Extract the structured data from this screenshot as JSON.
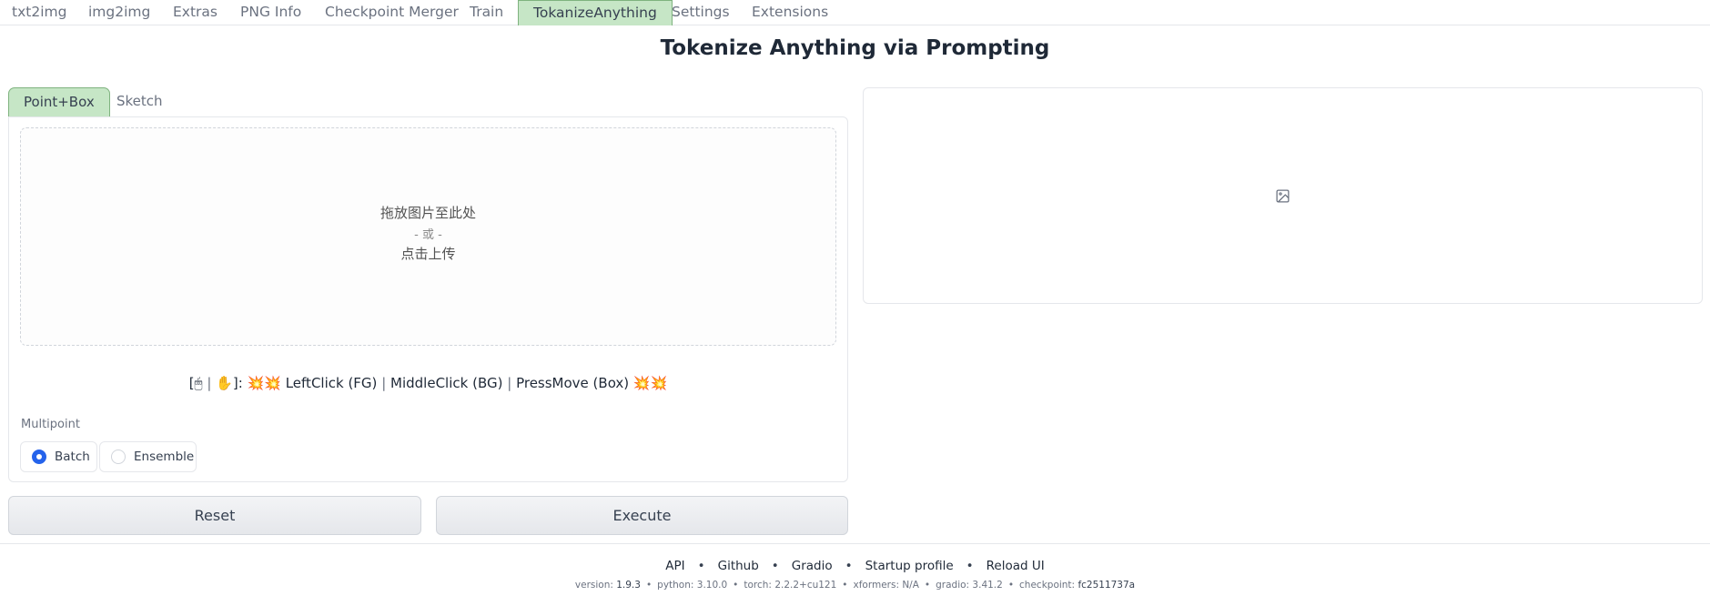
{
  "top_tabs": [
    {
      "label": "txt2img"
    },
    {
      "label": "img2img"
    },
    {
      "label": "Extras"
    },
    {
      "label": "PNG Info"
    },
    {
      "label": "Checkpoint Merger"
    },
    {
      "label": "Train"
    },
    {
      "label": "TokanizeAnything",
      "active": true
    },
    {
      "label": "Settings"
    },
    {
      "label": "Extensions"
    }
  ],
  "page_title": "Tokenize Anything via Prompting",
  "sub_tabs": [
    {
      "label": "Point+Box",
      "active": true
    },
    {
      "label": "Sketch"
    }
  ],
  "upload": {
    "line1": "拖放图片至此处",
    "line2": "- 或 -",
    "line3": "点击上传"
  },
  "hint": {
    "open": "[",
    "mouse_icon": "🖱",
    "sep1": "|",
    "hand_icon": "✋",
    "close": "]:",
    "spark_icon": "💥",
    "left": "LeftClick (FG)",
    "sep2": "|",
    "middle": "MiddleClick (BG)",
    "sep3": "|",
    "press": "PressMove (Box)"
  },
  "multipoint": {
    "label": "Multipoint",
    "options": [
      {
        "label": "Batch",
        "checked": true
      },
      {
        "label": "Ensemble",
        "checked": false
      }
    ]
  },
  "buttons": {
    "reset": "Reset",
    "execute": "Execute"
  },
  "right_panel": {
    "icon": "image-icon"
  },
  "footer": {
    "links": [
      "API",
      "Github",
      "Gradio",
      "Startup profile",
      "Reload UI"
    ],
    "separator": "•",
    "versions": [
      {
        "key": "version: ",
        "value": "1.9.3"
      },
      {
        "key": "python: ",
        "value": "3.10.0"
      },
      {
        "key": "torch: ",
        "value": "2.2.2+cu121"
      },
      {
        "key": "xformers: ",
        "value": "N/A"
      },
      {
        "key": "gradio: ",
        "value": "3.41.2"
      },
      {
        "key": "checkpoint: ",
        "value": "fc2511737a"
      }
    ]
  },
  "colors": {
    "active_tab_bg": "#c6e6c6",
    "active_tab_border": "#7fb37f",
    "radio_accent": "#2563eb"
  }
}
